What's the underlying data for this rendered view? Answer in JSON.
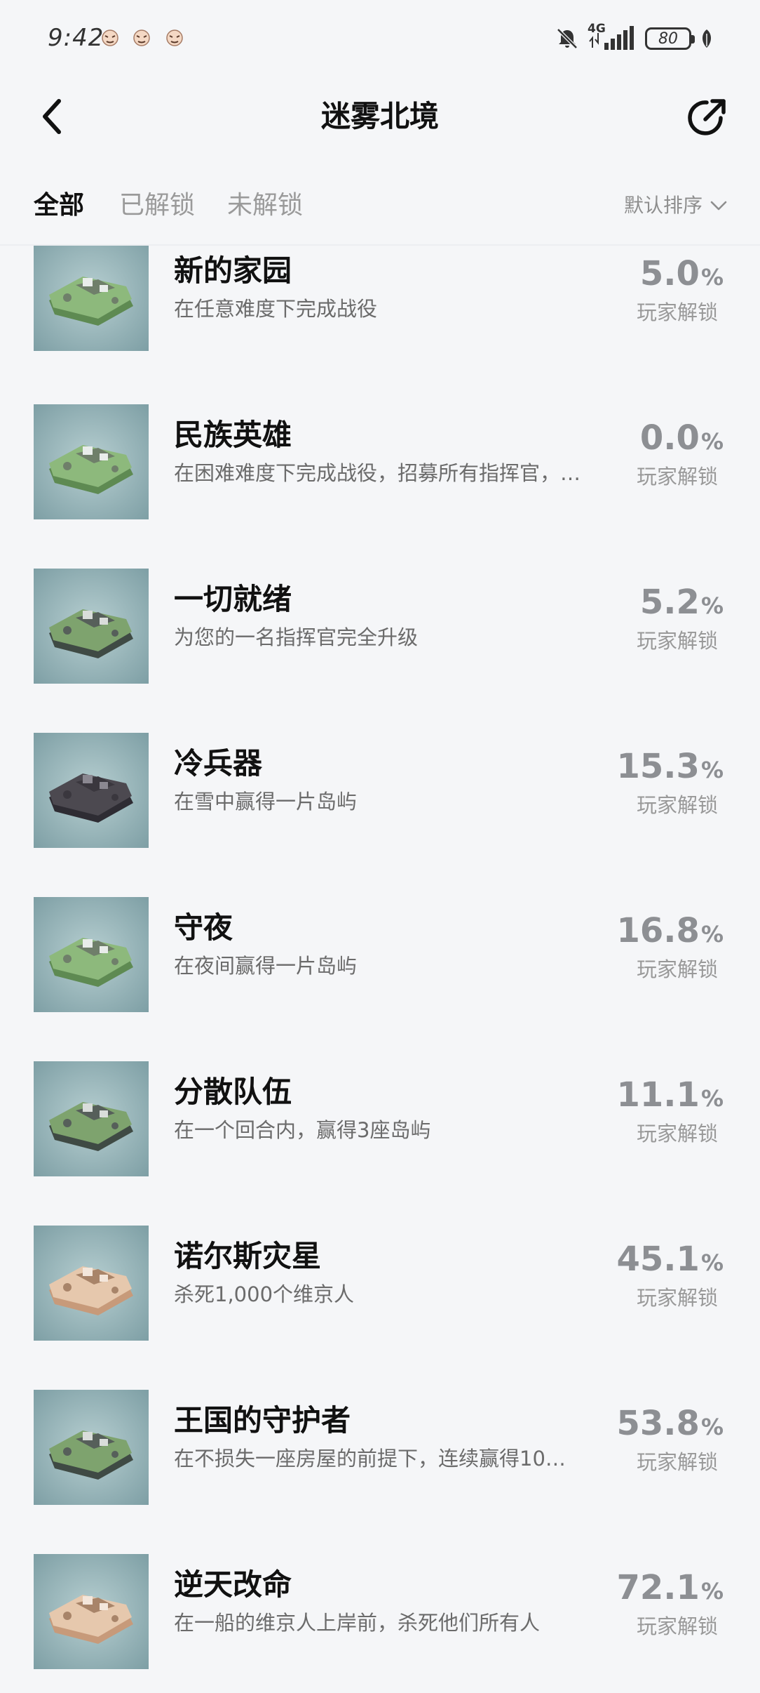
{
  "status_bar": {
    "time": "9:42",
    "network": "4G",
    "battery": "80"
  },
  "header": {
    "title": "迷雾北境"
  },
  "tabs": [
    {
      "label": "全部",
      "active": true
    },
    {
      "label": "已解锁",
      "active": false
    },
    {
      "label": "未解锁",
      "active": false
    }
  ],
  "sort": {
    "label": "默认排序"
  },
  "achievements": [
    {
      "title": "新的家园",
      "desc": "在任意难度下完成战役",
      "pct": "5.0",
      "unit": "%",
      "caption": "玩家解锁",
      "theme": "green"
    },
    {
      "title": "民族英雄",
      "desc": "在困难难度下完成战役，招募所有指挥官，…",
      "pct": "0.0",
      "unit": "%",
      "caption": "玩家解锁",
      "theme": "green"
    },
    {
      "title": "一切就绪",
      "desc": "为您的一名指挥官完全升级",
      "pct": "5.2",
      "unit": "%",
      "caption": "玩家解锁",
      "theme": "dark"
    },
    {
      "title": "冷兵器",
      "desc": "在雪中赢得一片岛屿",
      "pct": "15.3",
      "unit": "%",
      "caption": "玩家解锁",
      "theme": "night"
    },
    {
      "title": "守夜",
      "desc": "在夜间赢得一片岛屿",
      "pct": "16.8",
      "unit": "%",
      "caption": "玩家解锁",
      "theme": "green"
    },
    {
      "title": "分散队伍",
      "desc": "在一个回合内，赢得3座岛屿",
      "pct": "11.1",
      "unit": "%",
      "caption": "玩家解锁",
      "theme": "dark"
    },
    {
      "title": "诺尔斯灾星",
      "desc": "杀死1,000个维京人",
      "pct": "45.1",
      "unit": "%",
      "caption": "玩家解锁",
      "theme": "sand"
    },
    {
      "title": "王国的守护者",
      "desc": "在不损失一座房屋的前提下，连续赢得10…",
      "pct": "53.8",
      "unit": "%",
      "caption": "玩家解锁",
      "theme": "dark"
    },
    {
      "title": "逆天改命",
      "desc": "在一船的维京人上岸前，杀死他们所有人",
      "pct": "72.1",
      "unit": "%",
      "caption": "玩家解锁",
      "theme": "sand"
    }
  ],
  "colors": {
    "background": "#f5f6f8",
    "title": "#111111",
    "muted": "#8d8f93",
    "thumb_sea": "#8fb1b5"
  }
}
